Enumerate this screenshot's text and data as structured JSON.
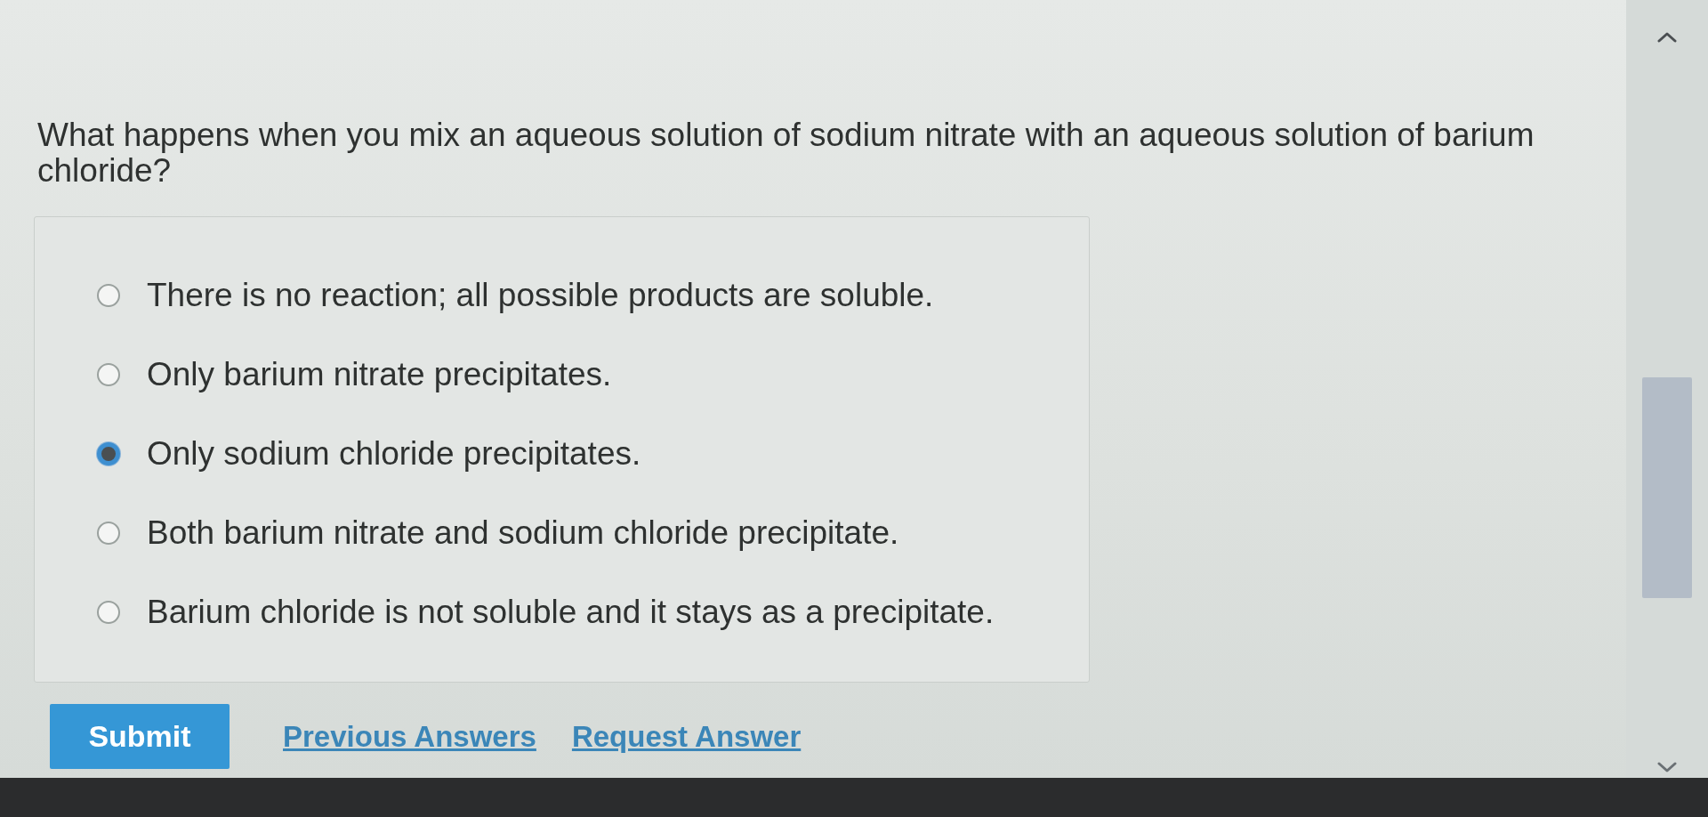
{
  "question": "What happens when you mix an aqueous solution of sodium nitrate with an aqueous solution of barium chloride?",
  "options": [
    {
      "label": "There is no reaction; all possible products are soluble.",
      "selected": false
    },
    {
      "label": "Only barium nitrate precipitates.",
      "selected": false
    },
    {
      "label": "Only sodium chloride precipitates.",
      "selected": true
    },
    {
      "label": "Both barium nitrate and sodium chloride precipitate.",
      "selected": false
    },
    {
      "label": "Barium chloride is not soluble and it stays as a precipitate.",
      "selected": false
    }
  ],
  "actions": {
    "submit": "Submit",
    "links": [
      "Previous Answers",
      "Request Answer"
    ]
  }
}
